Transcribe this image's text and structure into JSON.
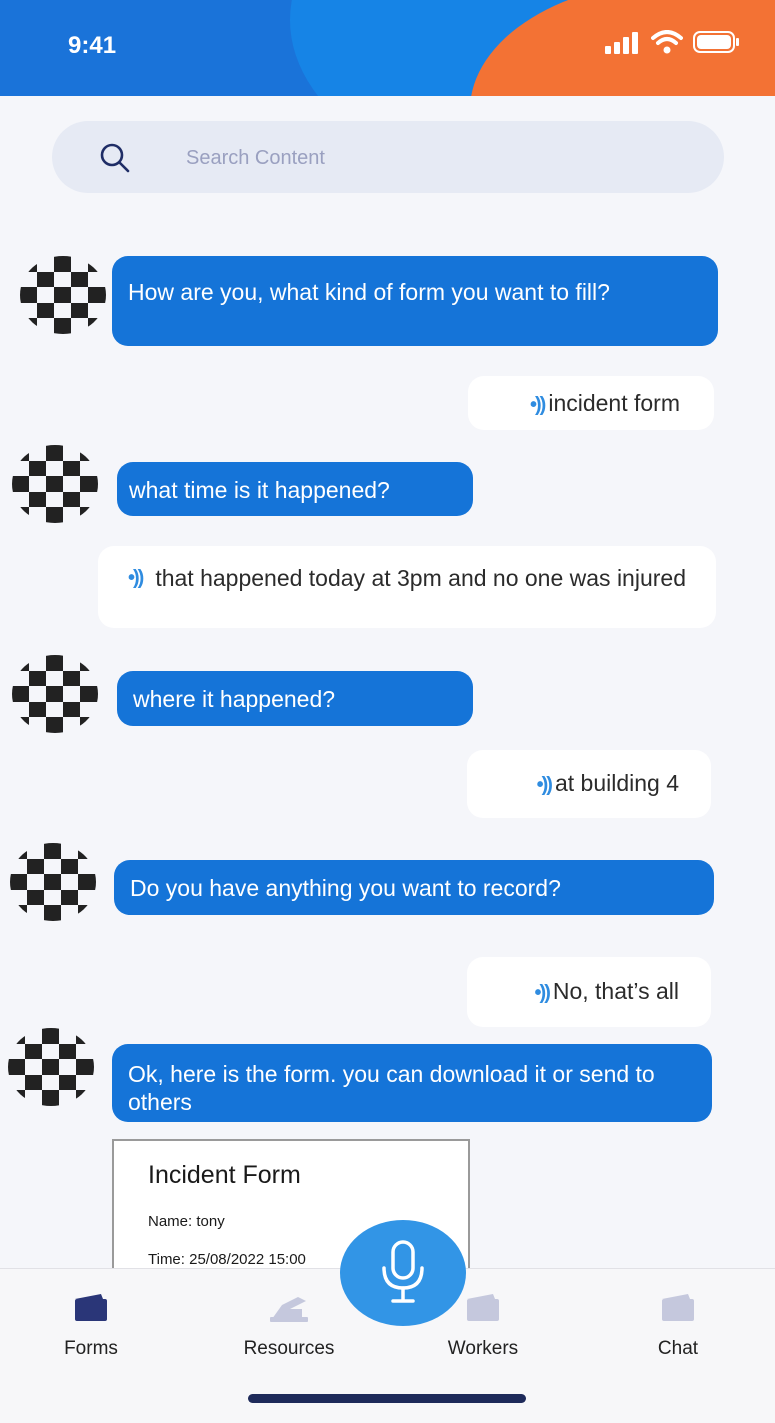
{
  "status": {
    "time": "9:41"
  },
  "search": {
    "placeholder": "Search Content"
  },
  "chat": {
    "messages": [
      {
        "from": "bot",
        "text": "How are you, what kind of form you want to fill?"
      },
      {
        "from": "user",
        "text": "incident form"
      },
      {
        "from": "bot",
        "text": "what time is it happened?"
      },
      {
        "from": "user",
        "text": "that happened today at 3pm and no one was injured"
      },
      {
        "from": "bot",
        "text": "where it happened?"
      },
      {
        "from": "user",
        "text": "at building 4"
      },
      {
        "from": "bot",
        "text": "Do you have anything you want to record?"
      },
      {
        "from": "user",
        "text": "No, that’s all"
      },
      {
        "from": "bot",
        "text": "Ok, here is the form. you can download it or send to others"
      }
    ]
  },
  "form_preview": {
    "title": "Incident Form",
    "name_row": "Name: tony",
    "time_row": "Time: 25/08/2022 15:00"
  },
  "tabs": [
    {
      "label": "Forms",
      "icon": "wallet-icon",
      "active": true
    },
    {
      "label": "Resources",
      "icon": "resources-icon",
      "active": false
    },
    {
      "label": "Workers",
      "icon": "wallet-icon",
      "active": false
    },
    {
      "label": "Chat",
      "icon": "wallet-icon",
      "active": false
    }
  ],
  "mic": {
    "icon": "microphone-icon"
  },
  "colors": {
    "accent": "#1574d8",
    "mic": "#3295e6",
    "header": "#1a73d9",
    "header_orange": "#f37234"
  }
}
